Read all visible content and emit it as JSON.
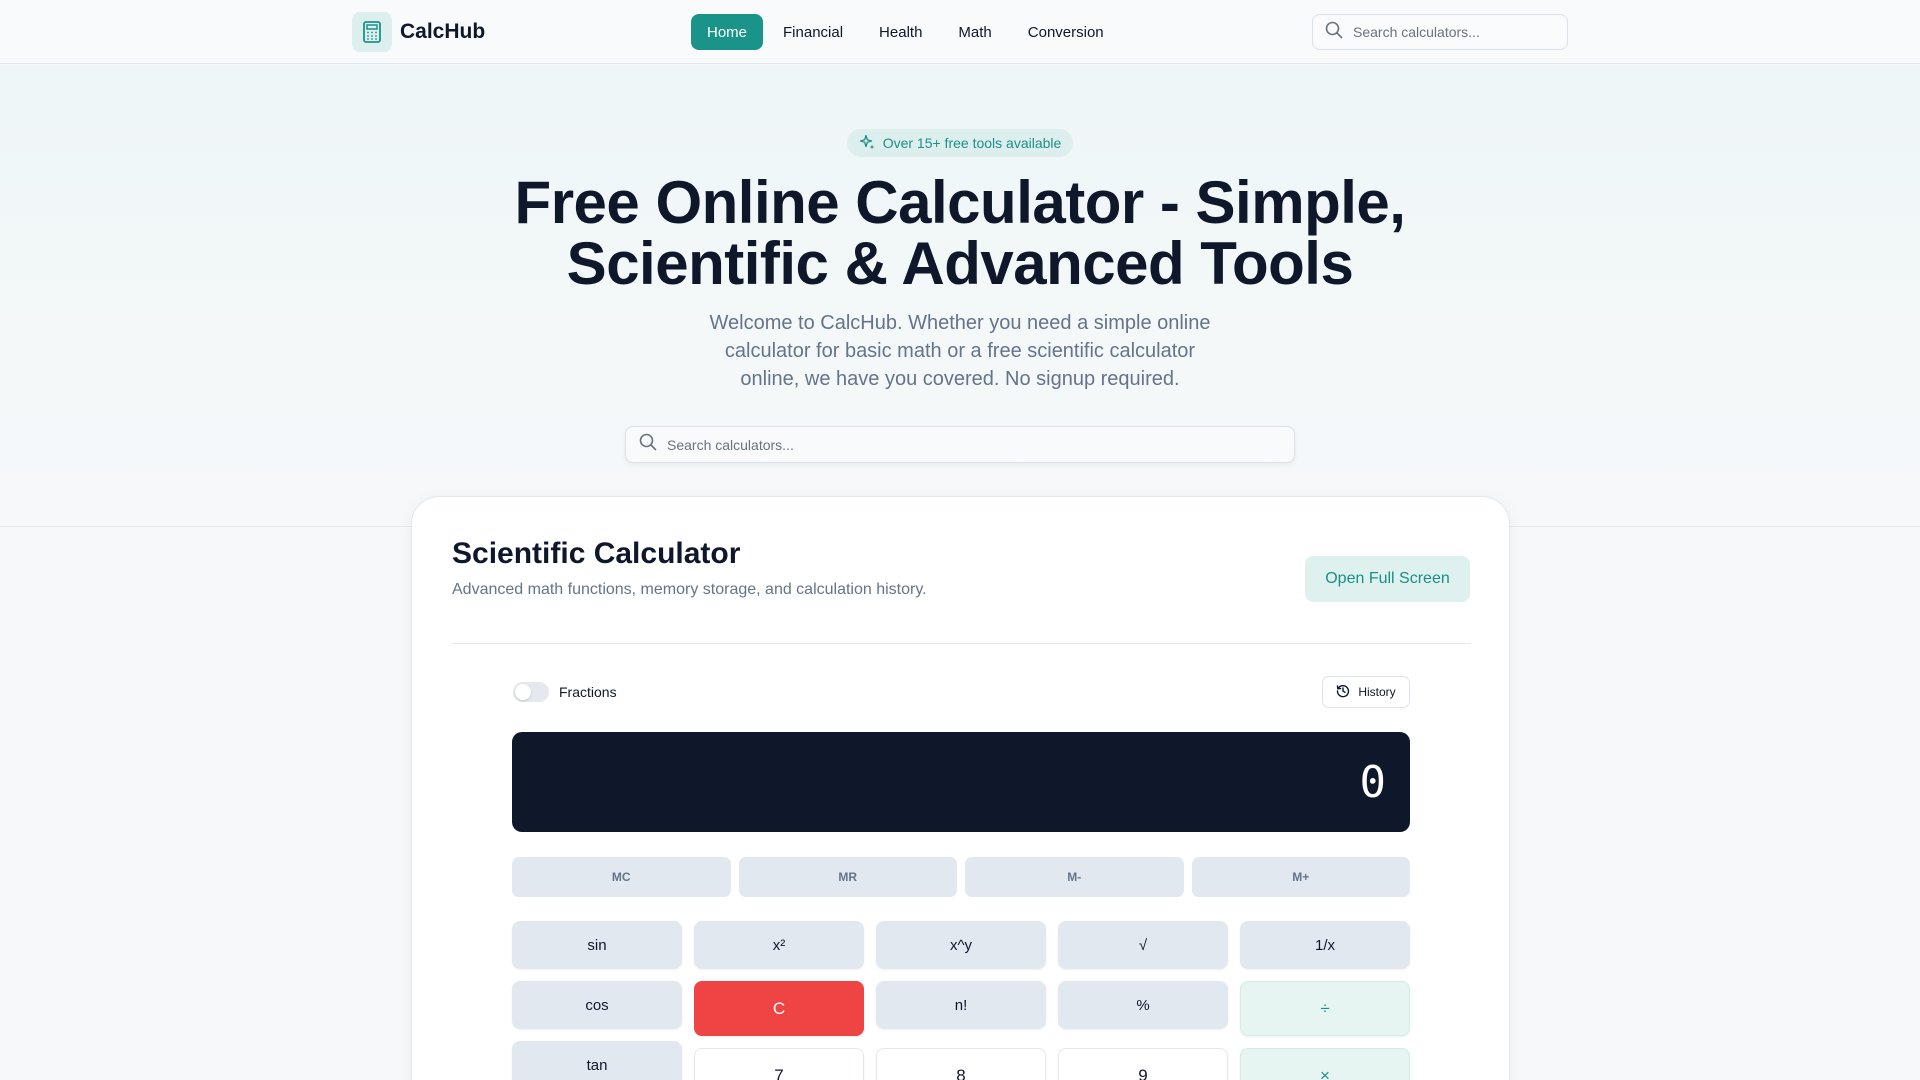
{
  "header": {
    "logo_text": "CalcHub",
    "nav": [
      "Home",
      "Financial",
      "Health",
      "Math",
      "Conversion"
    ],
    "active_nav": "Home",
    "search_placeholder": "Search calculators..."
  },
  "hero": {
    "badge": "Over 15+ free tools available",
    "title_line1": "Free Online Calculator - Simple,",
    "title_line2": "Scientific & Advanced Tools",
    "subtitle": "Welcome to CalcHub. Whether you need a simple online calculator for basic math or a free scientific calculator online, we have you covered. No signup required.",
    "search_placeholder": "Search calculators..."
  },
  "card": {
    "title": "Scientific Calculator",
    "subtitle": "Advanced math functions, memory storage, and calculation history.",
    "fullscreen_label": "Open Full Screen",
    "fractions_label": "Fractions",
    "fractions_enabled": false,
    "history_label": "History",
    "display_value": "0",
    "memory": [
      "MC",
      "MR",
      "M-",
      "M+"
    ],
    "keys": {
      "sin": "sin",
      "x2": "x²",
      "xpowy": "x^y",
      "sqrt": "√",
      "inv": "1/x",
      "cos": "cos",
      "clear": "C",
      "fact": "n!",
      "percent": "%",
      "divide": "÷",
      "tan": "tan",
      "seven": "7",
      "eight": "8",
      "nine": "9",
      "multiply": "×"
    }
  },
  "colors": {
    "accent": "#1a9389",
    "display_bg": "#0f172a",
    "clear": "#ef4444"
  }
}
